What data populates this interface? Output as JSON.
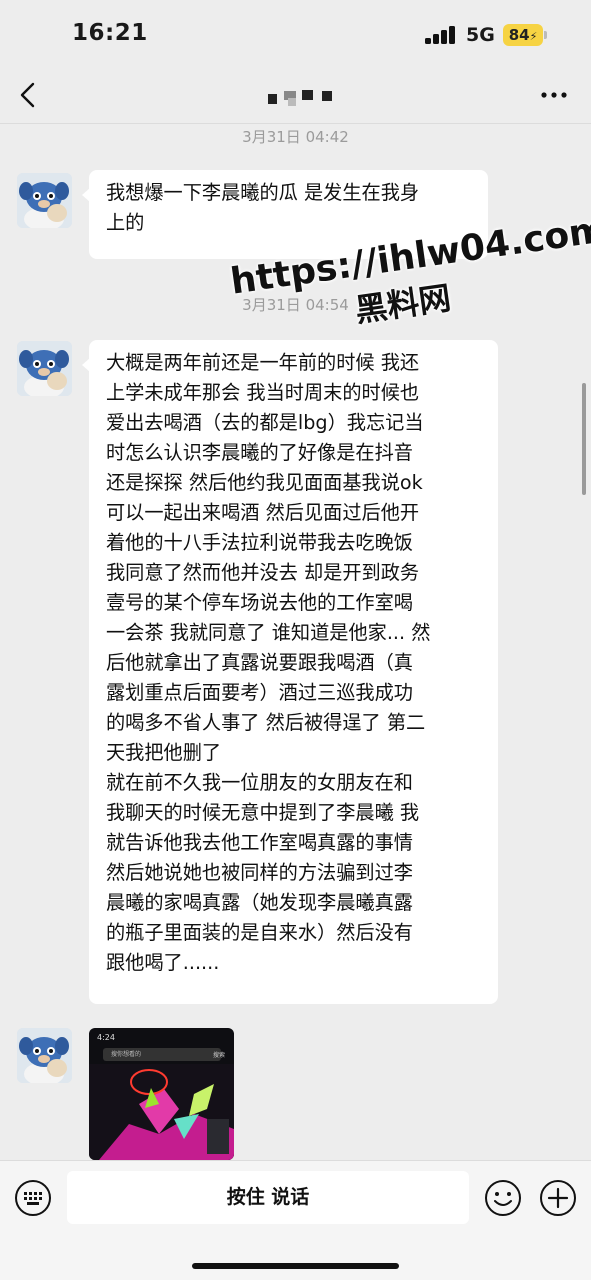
{
  "status_bar": {
    "time": "16:21",
    "network": "5G",
    "battery": "84"
  },
  "nav": {
    "back_icon": "chevron-left-icon",
    "title_mosaic_icon": "pixelated-name-icon",
    "more_icon": "more-dots-icon"
  },
  "messages": [
    {
      "type": "time",
      "text": "3月31日 04:42"
    },
    {
      "type": "text",
      "text": "我想爆一下李晨曦的瓜 是发生在我身\n上的"
    },
    {
      "type": "time",
      "text": "3月31日 04:54"
    },
    {
      "type": "text",
      "text": "大概是两年前还是一年前的时候 我还\n上学未成年那会 我当时周末的时候也\n爱出去喝酒（去的都是lbg）我忘记当\n时怎么认识李晨曦的了好像是在抖音\n还是探探 然后他约我见面面基我说ok\n可以一起出来喝酒 然后见面过后他开\n着他的十八手法拉利说带我去吃晚饭\n我同意了然而他并没去 却是开到政务\n壹号的某个停车场说去他的工作室喝\n一会茶 我就同意了 谁知道是他家... 然\n后他就拿出了真露说要跟我喝酒（真\n露划重点后面要考）酒过三巡我成功\n的喝多不省人事了 然后被得逞了 第二\n天我把他删了\n就在前不久我一位朋友的女朋友在和\n我聊天的时候无意中提到了李晨曦 我\n就告诉他我去他工作室喝真露的事情\n然后她说她也被同样的方法骗到过李\n晨曦的家喝真露（她发现李晨曦真露\n的瓶子里面装的是自来水）然后没有\n跟他喝了......"
    },
    {
      "type": "image",
      "screenshot_time": "4:24",
      "search_placeholder": "搜你想看的",
      "search_button": "搜索"
    }
  ],
  "watermark": {
    "url": "https://ihlw04.com",
    "site": "黑料网"
  },
  "bottom_bar": {
    "keyboard_icon": "keyboard-icon",
    "hold_to_talk": "按住 说话",
    "emoji_icon": "emoji-icon",
    "plus_icon": "plus-icon"
  },
  "colors": {
    "background": "#ededed",
    "bubble": "#ffffff",
    "battery": "#f6d343",
    "timestamp": "#9b9b9b"
  }
}
